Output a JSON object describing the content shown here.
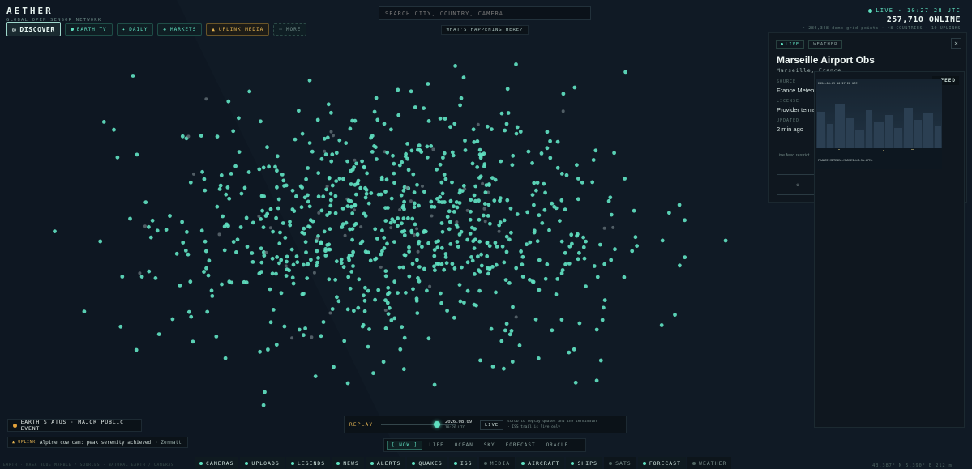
{
  "brand": {
    "title": "AETHER",
    "subtitle": "GLOBAL OPEN SENSOR NETWORK"
  },
  "nav": {
    "discover": "DISCOVER",
    "items": [
      "EARTH TV",
      "DAILY",
      "MARKETS",
      "UPLINK MEDIA",
      "MORE"
    ]
  },
  "search": {
    "placeholder": "SEARCH CITY, COUNTRY, CAMERA…"
  },
  "happening": "WHAT'S HAPPENING HERE?",
  "status": {
    "clock": "LIVE · 10:27:28 UTC",
    "online": "257,710 ONLINE",
    "sub": "• 286,348 demo grid points · 48 COUNTRIES · 10 UPLINKS"
  },
  "panel": {
    "live_tag": "LIVE",
    "weather_tag": "WEATHER",
    "close": "×",
    "title": "Marseille Airport Obs",
    "location": "Marseille, France",
    "source_label": "SOURCE",
    "source_value": "France Meteor",
    "license_label": "LICENSE",
    "license_value": "Provider terms",
    "updated_label": "UPDATED",
    "updated_value": "2 min ago",
    "notice": "Live feed restrict... reconstruction p...",
    "action": "☆"
  },
  "feed": {
    "badge": "FEED",
    "stamp": "2026-08-09 10:27:28 UTC",
    "caption": "FRANCE-METEORO-MARSEILLE-SA-LFML"
  },
  "earth_status": "EARTH STATUS · MAJOR PUBLIC EVENT",
  "uplink_msg": {
    "tag": "▲ UPLINK",
    "text": "Alpine cow cam: peak serenity achieved",
    "place": "· Zermatt"
  },
  "replay": {
    "label": "REPLAY",
    "date": "2026.08.09",
    "time": "10:26 UTC",
    "live": "LIVE",
    "hint_1": "scrub to replay quakes and the terminator",
    "hint_2": "· ISS trail is live only"
  },
  "modes": [
    "[ NOW ]",
    "LIFE",
    "OCEAN",
    "SKY",
    "FORECAST",
    "ORACLE"
  ],
  "layers": [
    {
      "label": "CAMERAS",
      "on": true
    },
    {
      "label": "UPLOADS",
      "on": true
    },
    {
      "label": "LEGENDS",
      "on": true
    },
    {
      "label": "NEWS",
      "on": true
    },
    {
      "label": "ALERTS",
      "on": true
    },
    {
      "label": "QUAKES",
      "on": true
    },
    {
      "label": "ISS",
      "on": true
    },
    {
      "label": "MEDIA",
      "on": false
    },
    {
      "label": "AIRCRAFT",
      "on": true
    },
    {
      "label": "SHIPS",
      "on": true
    },
    {
      "label": "SATS",
      "on": false
    },
    {
      "label": "FORECAST",
      "on": true
    },
    {
      "label": "WEATHER",
      "on": false
    }
  ],
  "credits": "EARTH · NASA BLUE MARBLE / SOURCES · NATURAL EARTH / CAMERAS",
  "coords": "43.387° N  5.390° E  212 m",
  "colors": {
    "accent": "#5fe0c0",
    "gold": "#e4b452",
    "bg": "#101a25"
  }
}
